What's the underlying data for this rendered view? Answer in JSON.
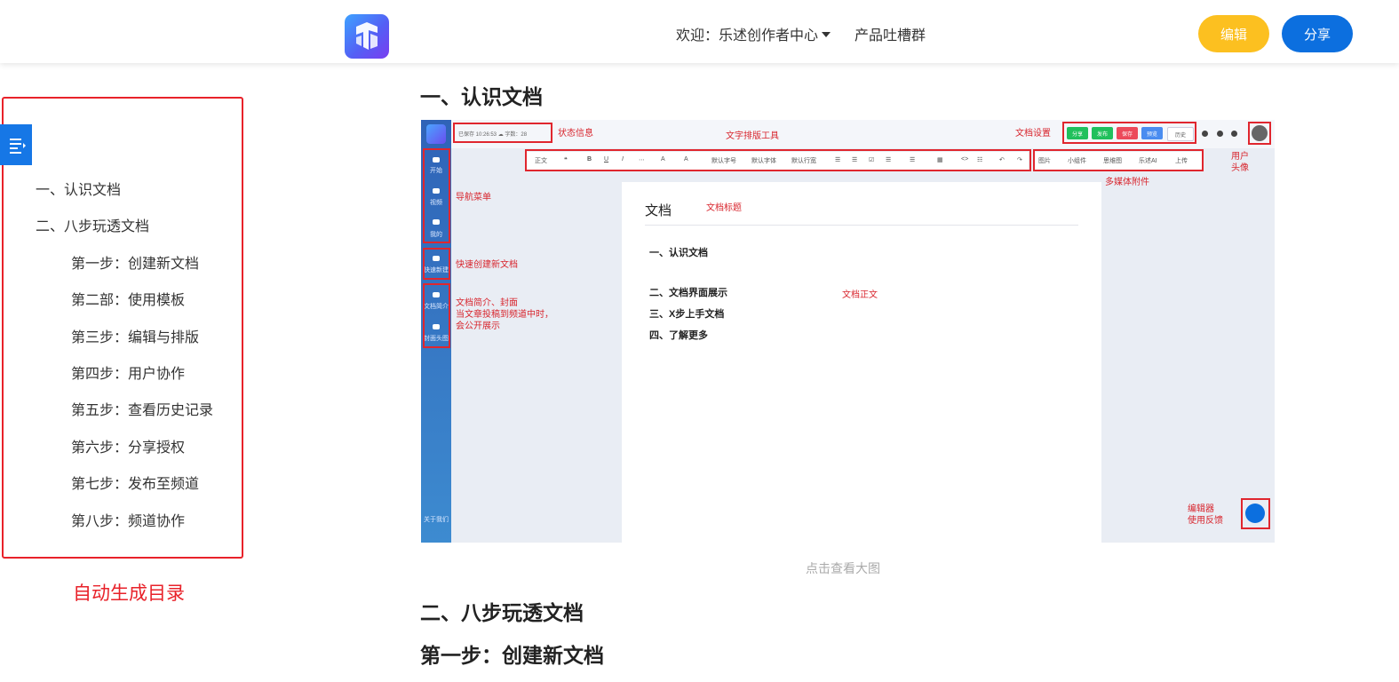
{
  "header": {
    "logo_icon": "app-logo-icon",
    "welcome": "欢迎：乐述创作者中心",
    "product_feedback": "产品吐槽群",
    "edit_label": "编辑",
    "share_label": "分享",
    "colors": {
      "edit": "#fcc020",
      "share": "#0c6fdf"
    }
  },
  "toc": {
    "toggle_icon": "outline-toggle-icon",
    "items": [
      "一、认识文档",
      "二、八步玩透文档",
      "第一步：创建新文档",
      "第二部：使用模板",
      "第三步：编辑与排版",
      "第四步：用户协作",
      "第五步：查看历史记录",
      "第六步：分享授权",
      "第七步：发布至频道",
      "第八步：频道协作"
    ],
    "note": "自动生成目录",
    "note_color": "#e8222a"
  },
  "content": {
    "heading1": "一、认识文档",
    "caption": "点击查看大图",
    "heading2": "二、八步玩透文档",
    "heading3": "第一步：创建新文档"
  },
  "screenshot": {
    "status": "已保存 10:26:53 ☁ 字数：28",
    "nav": [
      "开始",
      "视频",
      "我的"
    ],
    "quick_create": "快速新建",
    "intro": "文档简介",
    "cover": "封面头图",
    "about": "关于我们",
    "green_buttons": [
      "分享",
      "发布",
      "保存",
      "预览",
      "历史"
    ],
    "toolbar_left": [
      "正文",
      "❝",
      "B",
      "U",
      "I",
      "⋯",
      "A",
      "A",
      "默认字号",
      "默认字体",
      "默认行宽",
      "☰",
      "☰",
      "☑",
      "☰",
      "☰",
      "▦",
      "<>",
      "☷",
      "↶",
      "↷"
    ],
    "toolbar_right": [
      "图片",
      "小组件",
      "思维图",
      "乐述AI",
      "上传"
    ],
    "doc_title": "文档",
    "outline": [
      "一、认识文档",
      "二、文档界面展示",
      "三、X步上手文档",
      "四、了解更多"
    ],
    "labels": {
      "status_info": "状态信息",
      "typesetting": "文字排版工具",
      "doc_settings": "文档设置",
      "user_avatar": "用户\n头像",
      "media": "多媒体附件",
      "nav_menu": "导航菜单",
      "doc_title": "文档标题",
      "quick_create": "快速创建新文档",
      "intro_cover": "文档简介、封面\n当文章投稿到频道中时，\n会公开展示",
      "doc_body": "文档正文",
      "feedback": "编辑器\n使用反馈"
    }
  }
}
